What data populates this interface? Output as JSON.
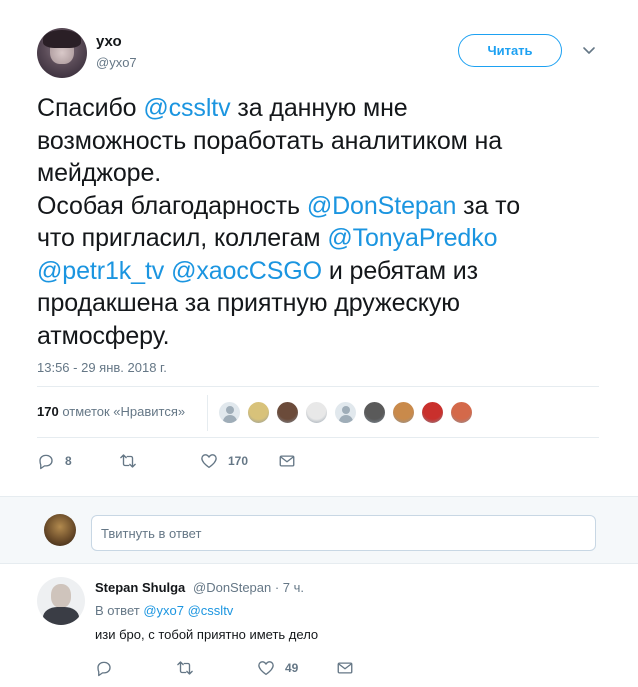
{
  "tweet": {
    "author_name": "ухо",
    "author_handle": "@yxo7",
    "follow_label": "Читать",
    "text_lines": [
      [
        {
          "t": "Спасибо "
        },
        {
          "t": "@cssltv",
          "m": true
        },
        {
          "t": " за данную мне"
        }
      ],
      [
        {
          "t": "возможность поработать аналитиком на"
        }
      ],
      [
        {
          "t": "мейджоре."
        }
      ],
      [
        {
          "t": "Особая благодарность "
        },
        {
          "t": "@DonStepan",
          "m": true
        },
        {
          "t": " за то"
        }
      ],
      [
        {
          "t": "что пригласил,  коллегам "
        },
        {
          "t": "@TonyaPredko",
          "m": true
        }
      ],
      [
        {
          "t": "@petr1k_tv",
          "m": true
        },
        {
          "t": " "
        },
        {
          "t": "@xaocCSGO",
          "m": true
        },
        {
          "t": " и ребятам из"
        }
      ],
      [
        {
          "t": "продакшена за приятную дружескую"
        }
      ],
      [
        {
          "t": "атмосферу."
        }
      ]
    ],
    "timestamp": "13:56 - 29 янв. 2018 г.",
    "likes_count": "170",
    "likes_label": " отметок «Нравится»",
    "actions": {
      "reply_count": "8",
      "retweet_count": "",
      "like_count": "170"
    }
  },
  "likers": [
    {
      "name": "liker-default-1",
      "color": "#c8d3dc"
    },
    {
      "name": "liker-2",
      "color": "#d8c27a"
    },
    {
      "name": "liker-3",
      "color": "#6b4b3a"
    },
    {
      "name": "liker-4",
      "color": "#e8e8e8"
    },
    {
      "name": "liker-default-5",
      "color": "#c8d3dc"
    },
    {
      "name": "liker-6",
      "color": "#5a5a5a"
    },
    {
      "name": "liker-7",
      "color": "#c98a4b"
    },
    {
      "name": "liker-8",
      "color": "#c9302c"
    },
    {
      "name": "liker-9",
      "color": "#d4694a"
    }
  ],
  "reply_box": {
    "placeholder": "Твитнуть в ответ"
  },
  "reply_tweet": {
    "author_name": "Stepan Shulga",
    "meta": "@DonStepan · 7 ч.",
    "reply_prefix": "В ответ ",
    "reply_to_1": "@yxo7",
    "reply_to_2": "@cssltv",
    "text": "изи бро, с тобой приятно иметь дело",
    "actions": {
      "reply_count": "",
      "retweet_count": "",
      "like_count": "49"
    }
  },
  "colors": {
    "accent": "#1da1f2",
    "mention": "#1b95e0",
    "muted": "#657786"
  }
}
